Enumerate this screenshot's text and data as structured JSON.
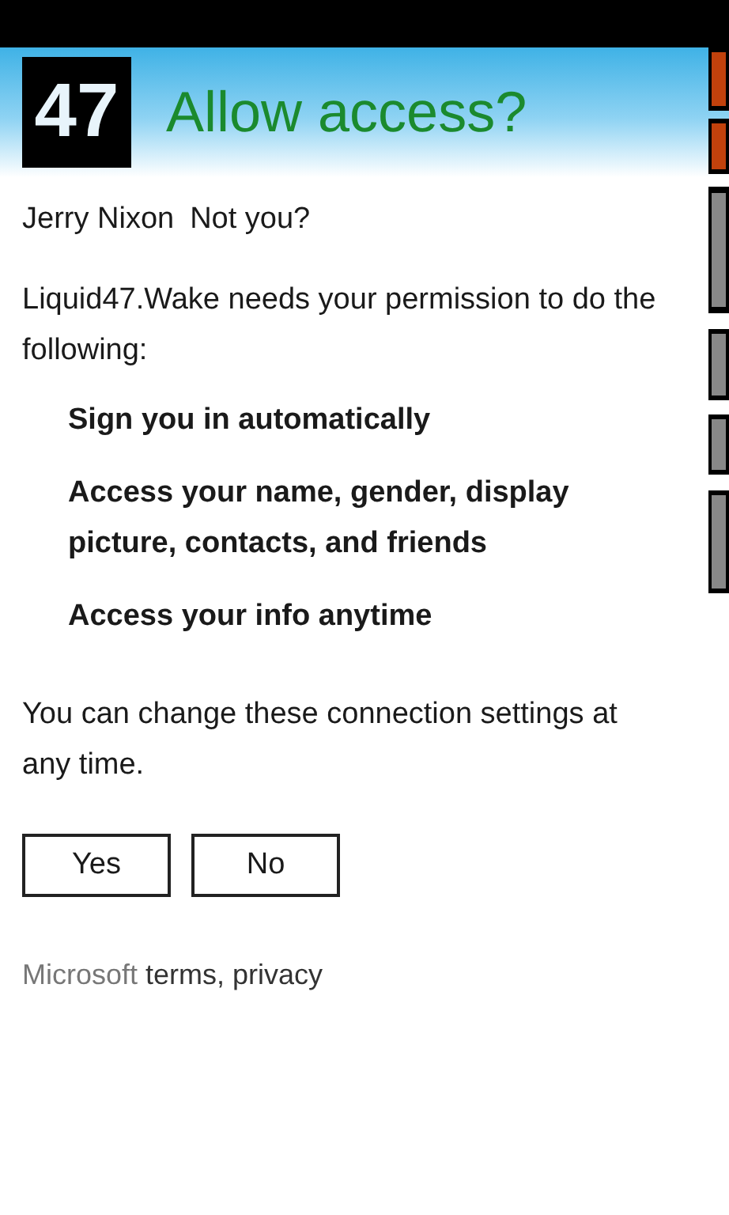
{
  "header": {
    "logo_text": "47",
    "title": "Allow access?"
  },
  "account": {
    "name": "Jerry Nixon",
    "switch_link": "Not you?"
  },
  "intro": "Liquid47.Wake needs your permission to do the following:",
  "permissions": [
    "Sign you in automatically",
    "Access your name, gender, display picture, contacts, and friends",
    "Access your info anytime"
  ],
  "note": "You can change these connection settings at any time.",
  "buttons": [
    "Yes",
    "No"
  ],
  "footer": {
    "brand": "Microsoft",
    "links": "terms, privacy"
  }
}
